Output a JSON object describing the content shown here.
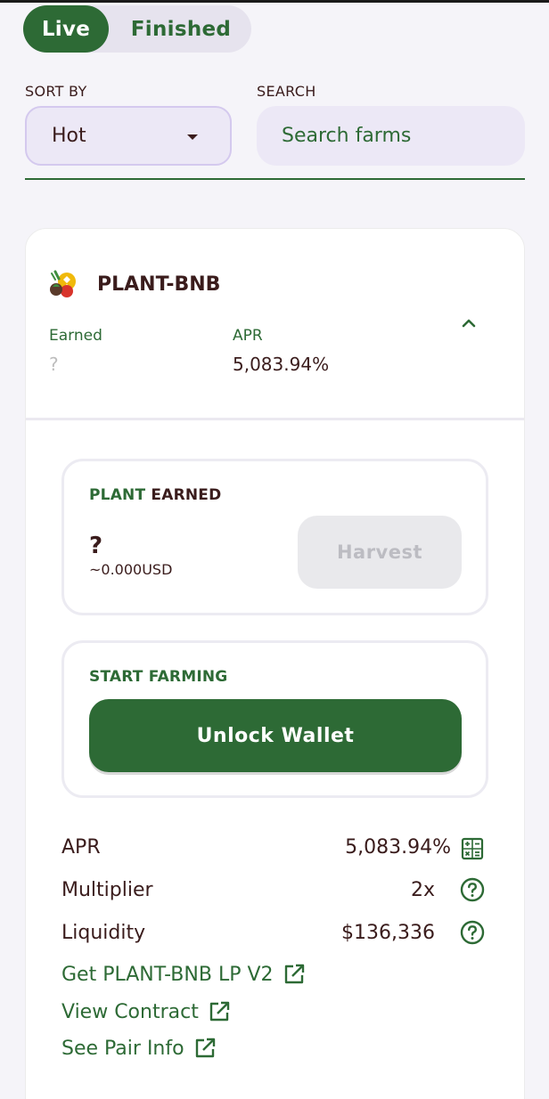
{
  "filter": {
    "live_label": "Live",
    "finished_label": "Finished"
  },
  "sort": {
    "label": "SORT BY",
    "value": "Hot"
  },
  "search": {
    "label": "SEARCH",
    "placeholder": "Search farms"
  },
  "farm": {
    "pair": "PLANT-BNB",
    "earned_label": "Earned",
    "earned_value": "?",
    "apr_label": "APR",
    "apr_value": "5,083.94%",
    "earned_box": {
      "title_token": "PLANT",
      "title_rest": " EARNED",
      "amount": "?",
      "usd": "~0.000USD",
      "harvest_label": "Harvest"
    },
    "farming_box": {
      "title": "START FARMING",
      "unlock_label": "Unlock Wallet"
    },
    "details": {
      "apr_label": "APR",
      "apr_value": "5,083.94%",
      "multiplier_label": "Multiplier",
      "multiplier_value": "2x",
      "liquidity_label": "Liquidity",
      "liquidity_value": "$136,336"
    },
    "links": {
      "get_lp": "Get PLANT-BNB LP V2",
      "view_contract": "View Contract",
      "pair_info": "See Pair Info"
    }
  },
  "colors": {
    "primary": "#2d6a35",
    "text": "#3a1c1c",
    "background": "#f5f4f9",
    "input_bg": "#ece8f6"
  },
  "icons": {
    "token": "plant-bnb-token-icon",
    "caret": "caret-down-icon",
    "collapse": "chevron-up-icon",
    "calculator": "calculator-icon",
    "help": "help-circle-icon",
    "external": "external-link-icon"
  }
}
